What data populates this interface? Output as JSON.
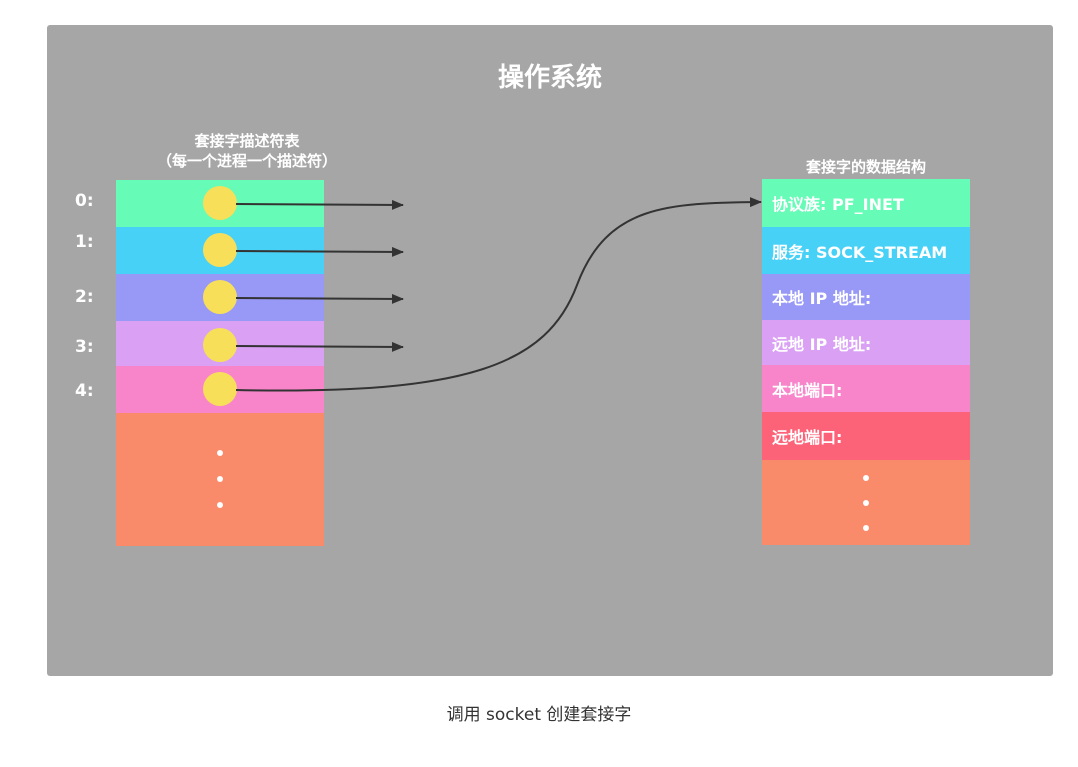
{
  "title": "操作系统",
  "fd_table": {
    "caption_line1": "套接字描述符表",
    "caption_line2": "（每一个进程一个描述符）",
    "rows": [
      {
        "label": "0:",
        "color": "#66fbb6"
      },
      {
        "label": "1:",
        "color": "#48d1f6"
      },
      {
        "label": "2:",
        "color": "#9898f7"
      },
      {
        "label": "3:",
        "color": "#d9a0f4"
      },
      {
        "label": "4:",
        "color": "#f884ca"
      }
    ],
    "rest_color": "#f98a6a"
  },
  "socket_struct": {
    "caption": "套接字的数据结构",
    "rows": [
      {
        "label": "协议族: PF_INET",
        "color": "#66fbb6"
      },
      {
        "label": "服务: SOCK_STREAM",
        "color": "#48d1f6"
      },
      {
        "label": "本地 IP 地址:",
        "color": "#9898f7"
      },
      {
        "label": "远地 IP 地址:",
        "color": "#d9a0f4"
      },
      {
        "label": "本地端口:",
        "color": "#f884ca"
      },
      {
        "label": "远地端口:",
        "color": "#fc6378"
      }
    ],
    "rest_color": "#f98a6a"
  },
  "dot_color": "#f7df5a",
  "caption": "调用 socket 创建套接字"
}
